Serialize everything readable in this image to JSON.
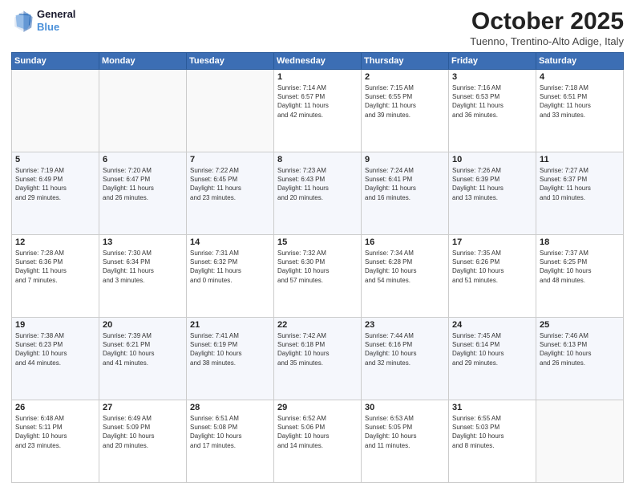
{
  "header": {
    "logo_line1": "General",
    "logo_line2": "Blue",
    "month": "October 2025",
    "location": "Tuenno, Trentino-Alto Adige, Italy"
  },
  "weekdays": [
    "Sunday",
    "Monday",
    "Tuesday",
    "Wednesday",
    "Thursday",
    "Friday",
    "Saturday"
  ],
  "weeks": [
    [
      {
        "day": "",
        "text": ""
      },
      {
        "day": "",
        "text": ""
      },
      {
        "day": "",
        "text": ""
      },
      {
        "day": "1",
        "text": "Sunrise: 7:14 AM\nSunset: 6:57 PM\nDaylight: 11 hours\nand 42 minutes."
      },
      {
        "day": "2",
        "text": "Sunrise: 7:15 AM\nSunset: 6:55 PM\nDaylight: 11 hours\nand 39 minutes."
      },
      {
        "day": "3",
        "text": "Sunrise: 7:16 AM\nSunset: 6:53 PM\nDaylight: 11 hours\nand 36 minutes."
      },
      {
        "day": "4",
        "text": "Sunrise: 7:18 AM\nSunset: 6:51 PM\nDaylight: 11 hours\nand 33 minutes."
      }
    ],
    [
      {
        "day": "5",
        "text": "Sunrise: 7:19 AM\nSunset: 6:49 PM\nDaylight: 11 hours\nand 29 minutes."
      },
      {
        "day": "6",
        "text": "Sunrise: 7:20 AM\nSunset: 6:47 PM\nDaylight: 11 hours\nand 26 minutes."
      },
      {
        "day": "7",
        "text": "Sunrise: 7:22 AM\nSunset: 6:45 PM\nDaylight: 11 hours\nand 23 minutes."
      },
      {
        "day": "8",
        "text": "Sunrise: 7:23 AM\nSunset: 6:43 PM\nDaylight: 11 hours\nand 20 minutes."
      },
      {
        "day": "9",
        "text": "Sunrise: 7:24 AM\nSunset: 6:41 PM\nDaylight: 11 hours\nand 16 minutes."
      },
      {
        "day": "10",
        "text": "Sunrise: 7:26 AM\nSunset: 6:39 PM\nDaylight: 11 hours\nand 13 minutes."
      },
      {
        "day": "11",
        "text": "Sunrise: 7:27 AM\nSunset: 6:37 PM\nDaylight: 11 hours\nand 10 minutes."
      }
    ],
    [
      {
        "day": "12",
        "text": "Sunrise: 7:28 AM\nSunset: 6:36 PM\nDaylight: 11 hours\nand 7 minutes."
      },
      {
        "day": "13",
        "text": "Sunrise: 7:30 AM\nSunset: 6:34 PM\nDaylight: 11 hours\nand 3 minutes."
      },
      {
        "day": "14",
        "text": "Sunrise: 7:31 AM\nSunset: 6:32 PM\nDaylight: 11 hours\nand 0 minutes."
      },
      {
        "day": "15",
        "text": "Sunrise: 7:32 AM\nSunset: 6:30 PM\nDaylight: 10 hours\nand 57 minutes."
      },
      {
        "day": "16",
        "text": "Sunrise: 7:34 AM\nSunset: 6:28 PM\nDaylight: 10 hours\nand 54 minutes."
      },
      {
        "day": "17",
        "text": "Sunrise: 7:35 AM\nSunset: 6:26 PM\nDaylight: 10 hours\nand 51 minutes."
      },
      {
        "day": "18",
        "text": "Sunrise: 7:37 AM\nSunset: 6:25 PM\nDaylight: 10 hours\nand 48 minutes."
      }
    ],
    [
      {
        "day": "19",
        "text": "Sunrise: 7:38 AM\nSunset: 6:23 PM\nDaylight: 10 hours\nand 44 minutes."
      },
      {
        "day": "20",
        "text": "Sunrise: 7:39 AM\nSunset: 6:21 PM\nDaylight: 10 hours\nand 41 minutes."
      },
      {
        "day": "21",
        "text": "Sunrise: 7:41 AM\nSunset: 6:19 PM\nDaylight: 10 hours\nand 38 minutes."
      },
      {
        "day": "22",
        "text": "Sunrise: 7:42 AM\nSunset: 6:18 PM\nDaylight: 10 hours\nand 35 minutes."
      },
      {
        "day": "23",
        "text": "Sunrise: 7:44 AM\nSunset: 6:16 PM\nDaylight: 10 hours\nand 32 minutes."
      },
      {
        "day": "24",
        "text": "Sunrise: 7:45 AM\nSunset: 6:14 PM\nDaylight: 10 hours\nand 29 minutes."
      },
      {
        "day": "25",
        "text": "Sunrise: 7:46 AM\nSunset: 6:13 PM\nDaylight: 10 hours\nand 26 minutes."
      }
    ],
    [
      {
        "day": "26",
        "text": "Sunrise: 6:48 AM\nSunset: 5:11 PM\nDaylight: 10 hours\nand 23 minutes."
      },
      {
        "day": "27",
        "text": "Sunrise: 6:49 AM\nSunset: 5:09 PM\nDaylight: 10 hours\nand 20 minutes."
      },
      {
        "day": "28",
        "text": "Sunrise: 6:51 AM\nSunset: 5:08 PM\nDaylight: 10 hours\nand 17 minutes."
      },
      {
        "day": "29",
        "text": "Sunrise: 6:52 AM\nSunset: 5:06 PM\nDaylight: 10 hours\nand 14 minutes."
      },
      {
        "day": "30",
        "text": "Sunrise: 6:53 AM\nSunset: 5:05 PM\nDaylight: 10 hours\nand 11 minutes."
      },
      {
        "day": "31",
        "text": "Sunrise: 6:55 AM\nSunset: 5:03 PM\nDaylight: 10 hours\nand 8 minutes."
      },
      {
        "day": "",
        "text": ""
      }
    ]
  ]
}
